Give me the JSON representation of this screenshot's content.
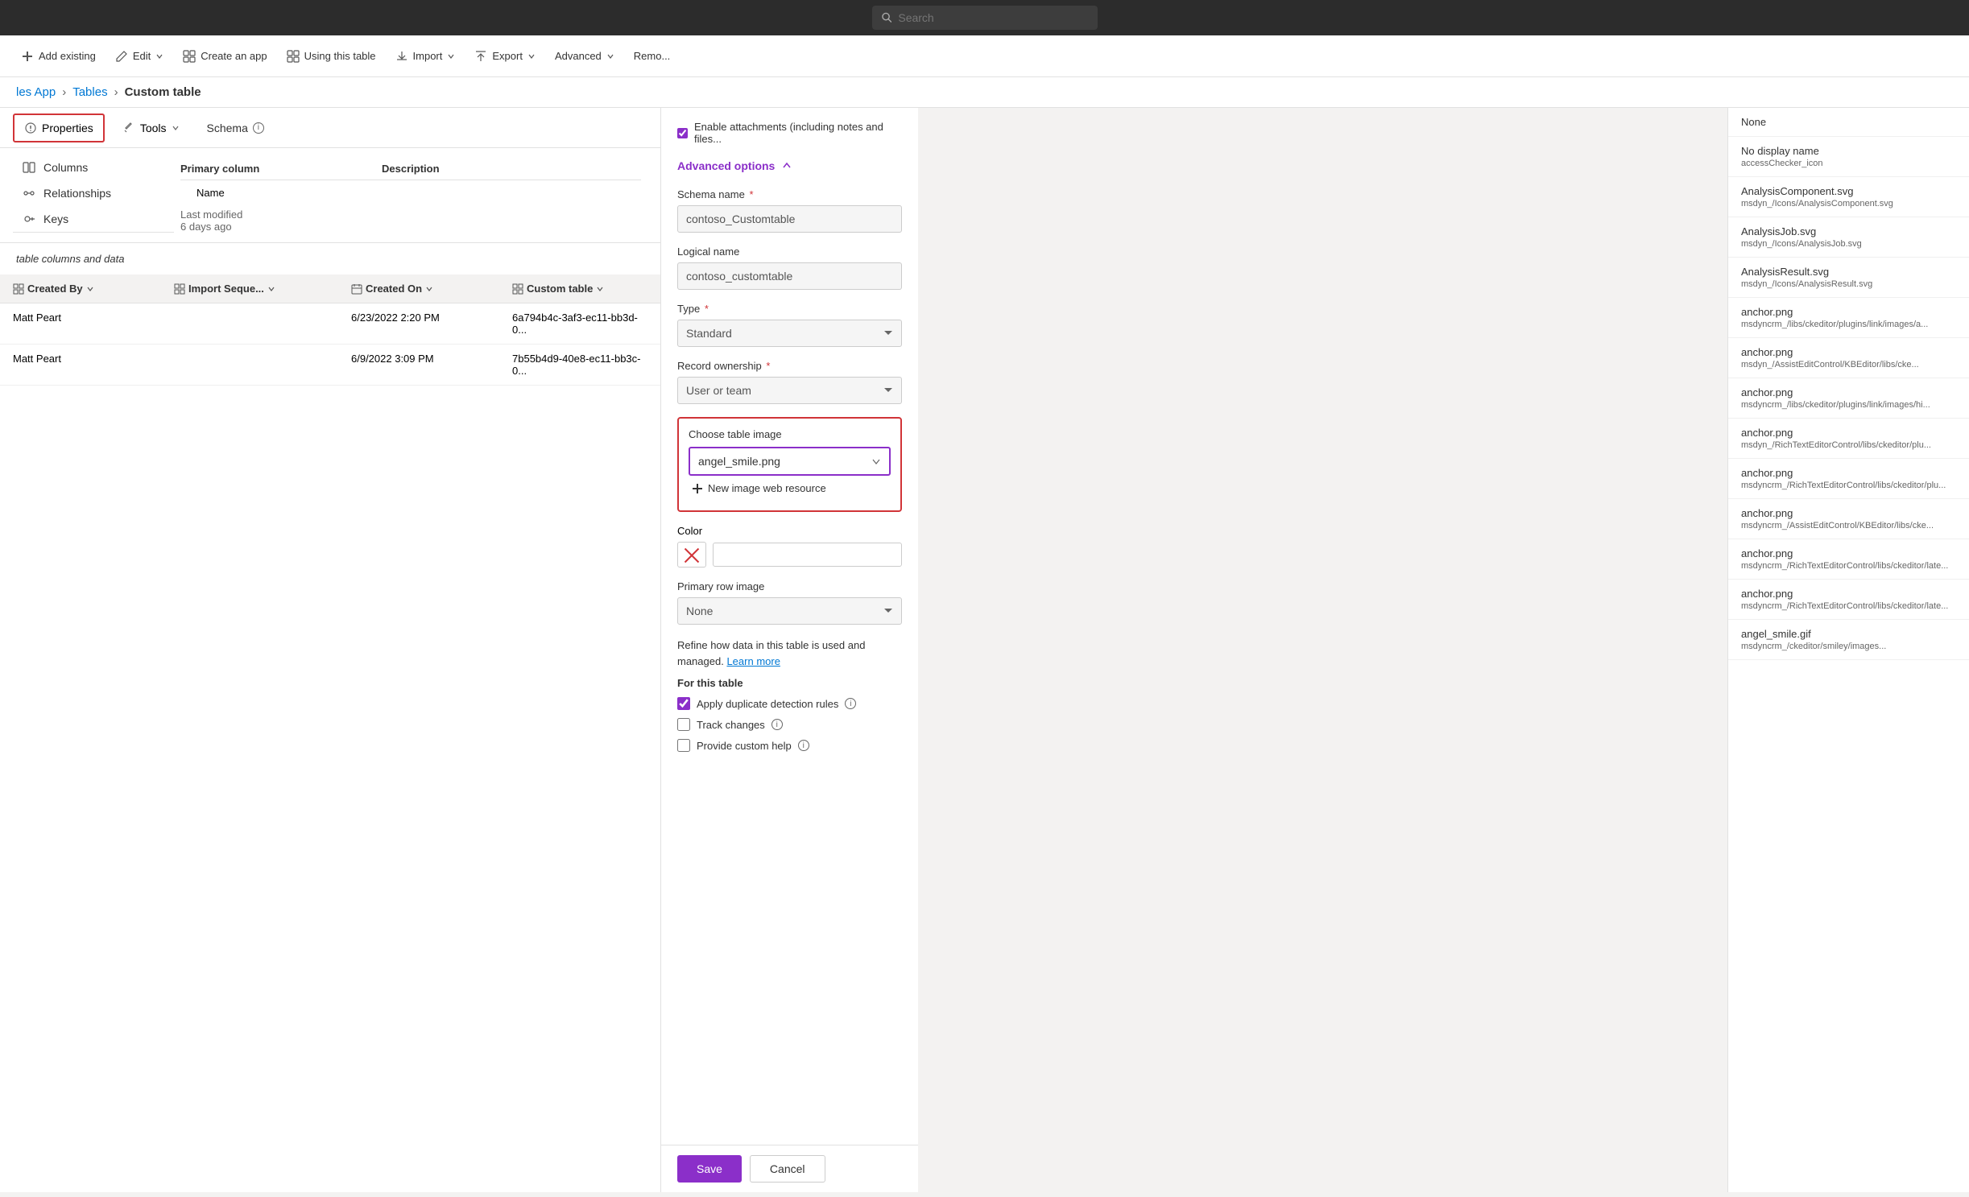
{
  "topbar": {
    "search_placeholder": "Search"
  },
  "toolbar": {
    "add_existing": "Add existing",
    "edit": "Edit",
    "create_app": "Create an app",
    "using_this_table": "Using this table",
    "import": "Import",
    "export": "Export",
    "advanced": "Advanced",
    "remove": "Remo..."
  },
  "breadcrumb": {
    "app": "les App",
    "tables": "Tables",
    "current": "Custom table"
  },
  "subtabs": {
    "properties_label": "Properties",
    "tools_label": "Tools",
    "schema_label": "Schema"
  },
  "schema_nav": {
    "columns": "Columns",
    "relationships": "Relationships",
    "keys": "Keys"
  },
  "table_columns_label": "table columns and data",
  "columns_header": {
    "primary_column": "Primary column",
    "description": "Description"
  },
  "columns": {
    "name_label": "Name",
    "last_modified": "Last modified",
    "days_ago": "6 days ago"
  },
  "data_table": {
    "headers": [
      "Created By",
      "Import Seque...",
      "Created On",
      "Custom table"
    ],
    "rows": [
      {
        "created_by": "Matt Peart",
        "import_seq": "",
        "created_on": "6/23/2022 2:20 PM",
        "custom_table": "6a794b4c-3af3-ec11-bb3d-0..."
      },
      {
        "created_by": "Matt Peart",
        "import_seq": "",
        "created_on": "6/9/2022 3:09 PM",
        "custom_table": "7b55b4d9-40e8-ec11-bb3c-0..."
      }
    ]
  },
  "properties_panel": {
    "enable_attachments_label": "Enable attachments (including notes and files...",
    "adv_options_label": "Advanced options",
    "schema_name_label": "Schema name",
    "schema_name_req": "*",
    "schema_name_value": "contoso_Customtable",
    "logical_name_label": "Logical name",
    "logical_name_value": "contoso_customtable",
    "type_label": "Type",
    "type_req": "*",
    "type_value": "Standard",
    "record_ownership_label": "Record ownership",
    "record_ownership_req": "*",
    "record_ownership_value": "User or team",
    "choose_image_label": "Choose table image",
    "image_value": "angel_smile.png",
    "new_image_label": "New image web resource",
    "color_label": "Color",
    "primary_row_image_label": "Primary row image",
    "primary_row_image_value": "None",
    "refine_text": "Refine how data in this table is used and managed.",
    "learn_more_label": "Learn more",
    "for_this_table_label": "For this table",
    "apply_duplicate_label": "Apply duplicate detection rules",
    "track_changes_label": "Track changes",
    "provide_custom_help_label": "Provide custom help",
    "save_label": "Save",
    "cancel_label": "Cancel"
  },
  "dropdown_list": {
    "items": [
      {
        "primary": "None",
        "secondary": ""
      },
      {
        "primary": "No display name",
        "secondary": "accessChecker_icon"
      },
      {
        "primary": "AnalysisComponent.svg",
        "secondary": "msdyn_/Icons/AnalysisComponent.svg"
      },
      {
        "primary": "AnalysisJob.svg",
        "secondary": "msdyn_/Icons/AnalysisJob.svg"
      },
      {
        "primary": "AnalysisResult.svg",
        "secondary": "msdyn_/Icons/AnalysisResult.svg"
      },
      {
        "primary": "anchor.png",
        "secondary": "msdyncrm_/libs/ckeditor/plugins/link/images/a..."
      },
      {
        "primary": "anchor.png",
        "secondary": "msdyn_/AssistEditControl/KBEditor/libs/cke..."
      },
      {
        "primary": "anchor.png",
        "secondary": "msdyncrm_/libs/ckeditor/plugins/link/images/hi..."
      },
      {
        "primary": "anchor.png",
        "secondary": "msdyn_/RichTextEditorControl/libs/ckeditor/plu..."
      },
      {
        "primary": "anchor.png",
        "secondary": "msdyncrm_/RichTextEditorControl/libs/ckeditor/plu..."
      },
      {
        "primary": "anchor.png",
        "secondary": "msdyncrm_/AssistEditControl/KBEditor/libs/cke..."
      },
      {
        "primary": "anchor.png",
        "secondary": "msdyncrm_/RichTextEditorControl/libs/ckeditor/late..."
      },
      {
        "primary": "anchor.png",
        "secondary": "msdyncrm_/RichTextEditorControl/libs/ckeditor/late..."
      },
      {
        "primary": "angel_smile.gif",
        "secondary": "msdyncrm_/ckeditor/smiley/images..."
      }
    ]
  }
}
